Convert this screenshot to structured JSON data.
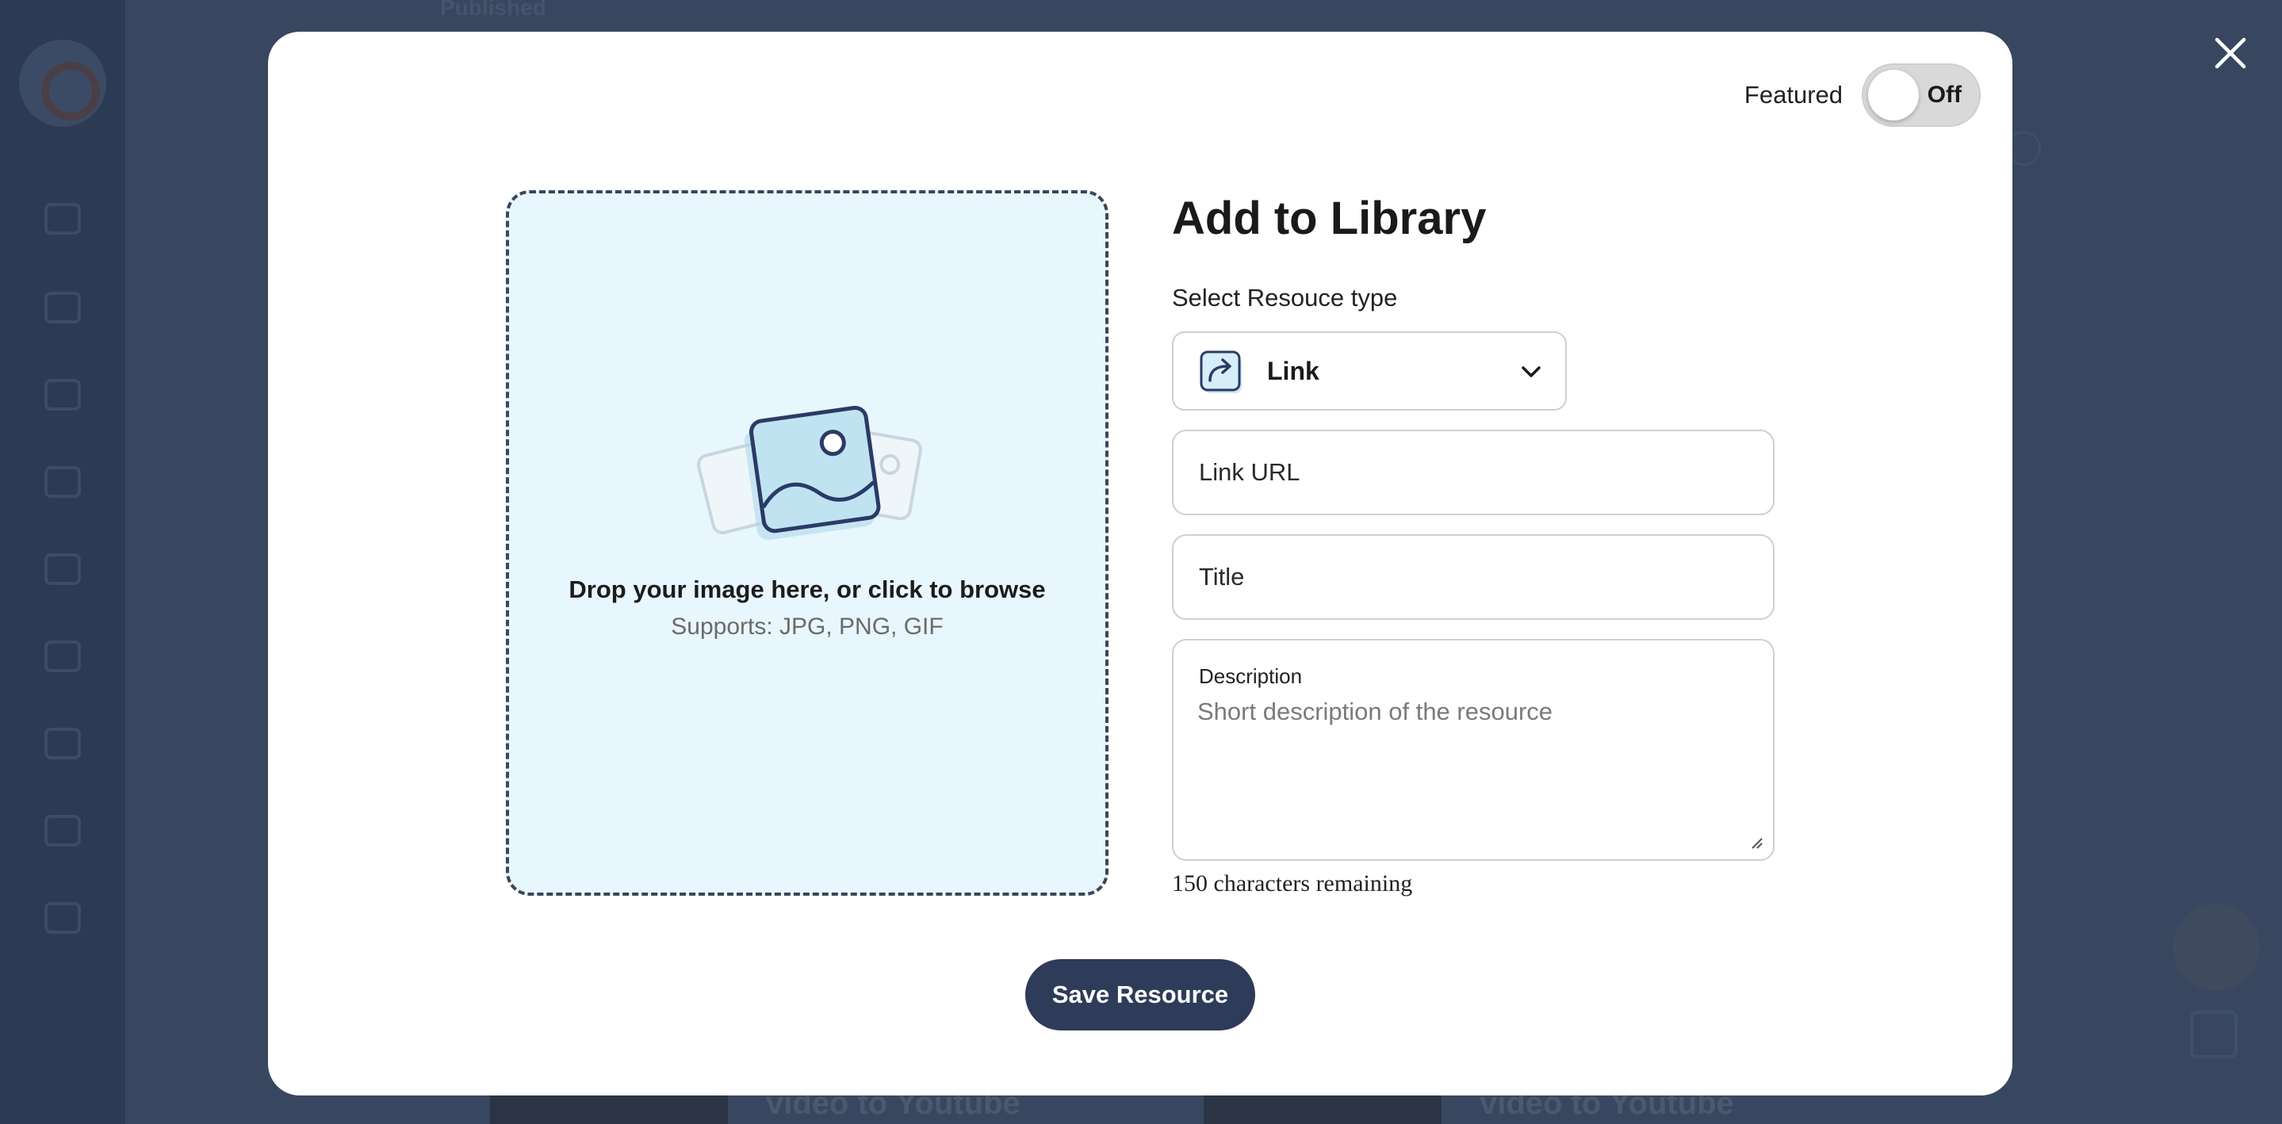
{
  "background": {
    "card_titles": [
      "video to Youtube",
      "video to Youtube"
    ],
    "topbar_status": "Published"
  },
  "modal": {
    "featured": {
      "label": "Featured",
      "state": "Off"
    },
    "dropzone": {
      "title": "Drop your image here, or click to browse",
      "subtitle": "Supports: JPG, PNG, GIF"
    },
    "form": {
      "title": "Add to Library",
      "type_label": "Select Resouce type",
      "type_value": "Link",
      "link_url_placeholder": "Link URL",
      "title_placeholder": "Title",
      "description_label": "Description",
      "description_placeholder": "Short description of the resource",
      "chars_remaining": "150 characters remaining"
    },
    "save_label": "Save Resource"
  },
  "colors": {
    "overlay": "#2f3d5a",
    "dropzone_bg": "#e8f6fd",
    "primary_button": "#2e3b59",
    "toggle_off": "#d9d9d9"
  },
  "icons": {
    "close": "close-icon",
    "image_placeholder": "image-gallery-icon",
    "link_type": "link-share-icon",
    "chevron": "chevron-down-icon"
  }
}
